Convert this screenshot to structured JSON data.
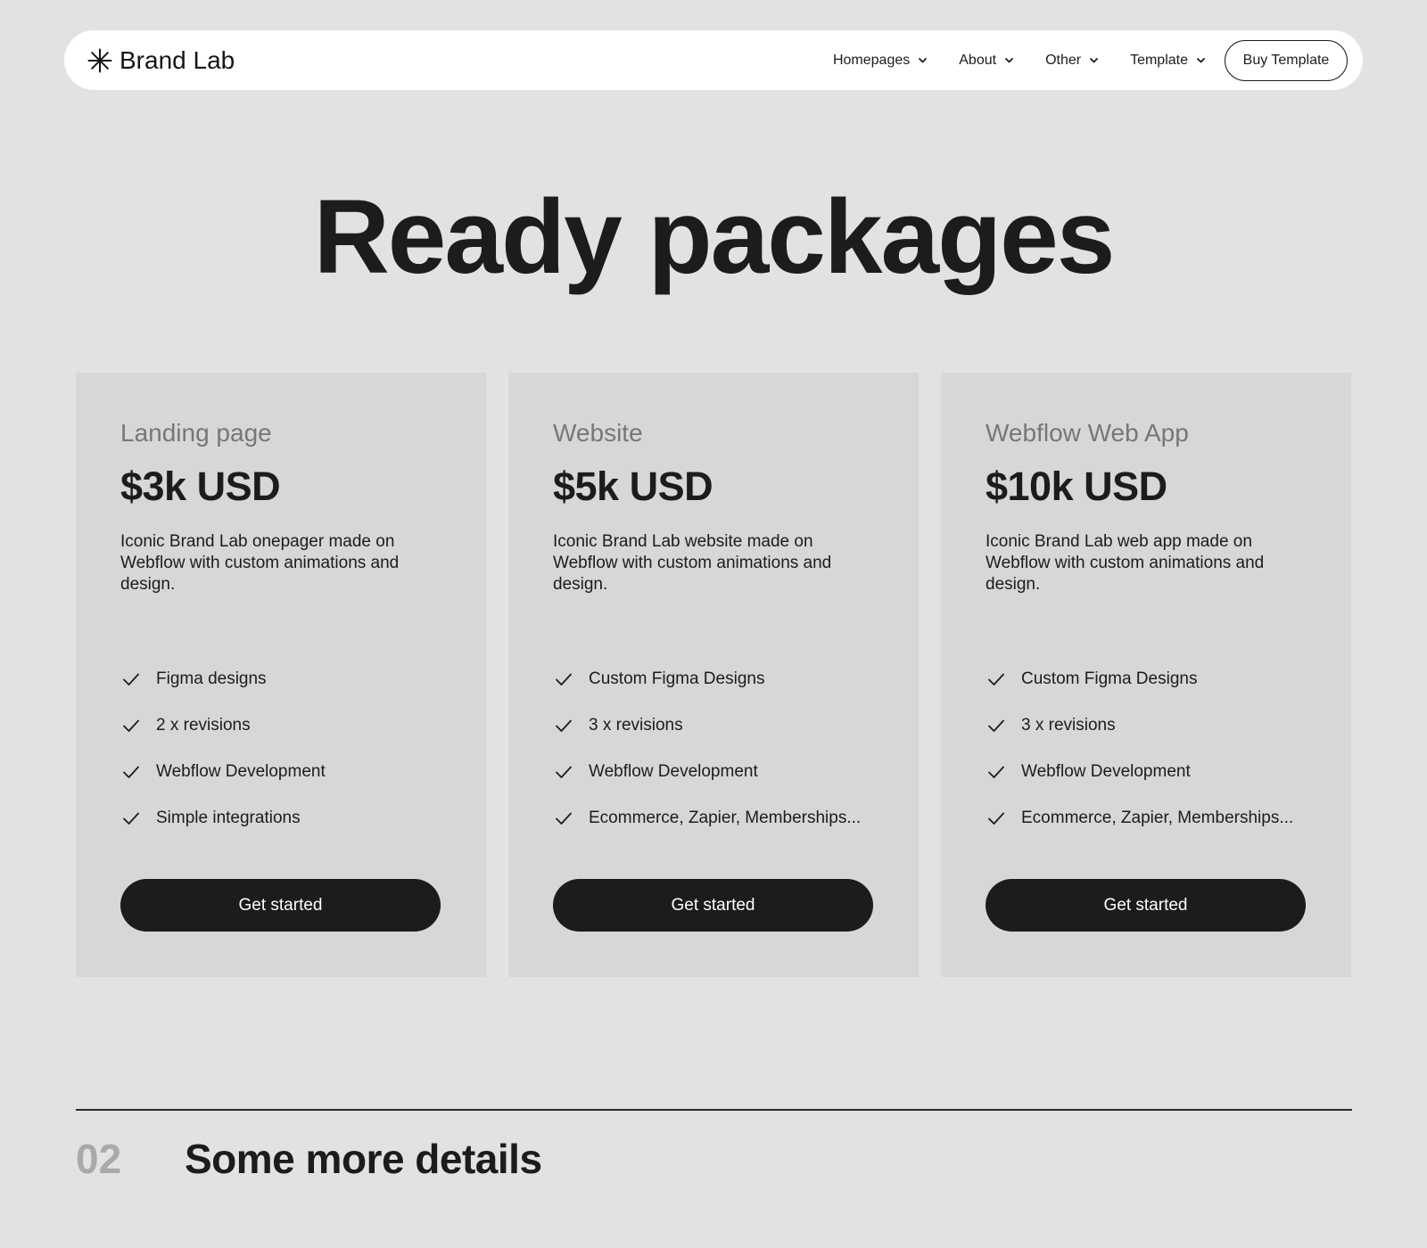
{
  "nav": {
    "brand": "Brand Lab",
    "logo_icon": "asterisk-icon",
    "links": [
      {
        "label": "Homepages",
        "icon": "chevron-down-icon"
      },
      {
        "label": "About",
        "icon": "chevron-down-icon"
      },
      {
        "label": "Other",
        "icon": "chevron-down-icon"
      },
      {
        "label": "Template",
        "icon": "chevron-down-icon"
      }
    ],
    "cta": "Buy Template"
  },
  "hero": {
    "title": "Ready packages"
  },
  "packages": [
    {
      "name": "Landing page",
      "price": "$3k USD",
      "description": "Iconic Brand Lab onepager made on Webflow with custom animations and design.",
      "features": [
        "Figma designs",
        "2 x revisions",
        "Webflow Development",
        "Simple integrations"
      ],
      "cta": "Get started"
    },
    {
      "name": "Website",
      "price": "$5k USD",
      "description": "Iconic Brand Lab website made on Webflow with custom animations and design.",
      "features": [
        "Custom Figma Designs",
        "3 x revisions",
        "Webflow Development",
        "Ecommerce, Zapier, Memberships..."
      ],
      "cta": "Get started"
    },
    {
      "name": "Webflow Web App",
      "price": "$10k USD",
      "description": "Iconic Brand Lab web app made on Webflow with custom animations and design.",
      "features": [
        "Custom Figma Designs",
        "3 x revisions",
        "Webflow Development",
        "Ecommerce, Zapier, Memberships..."
      ],
      "cta": "Get started"
    }
  ],
  "next_section": {
    "number": "02",
    "title": "Some more details"
  },
  "colors": {
    "background": "#e2e2e2",
    "card": "#d7d7d7",
    "text": "#1c1c1c",
    "muted": "#777777",
    "section_number": "#a9a9a9",
    "button": "#1c1c1c"
  }
}
